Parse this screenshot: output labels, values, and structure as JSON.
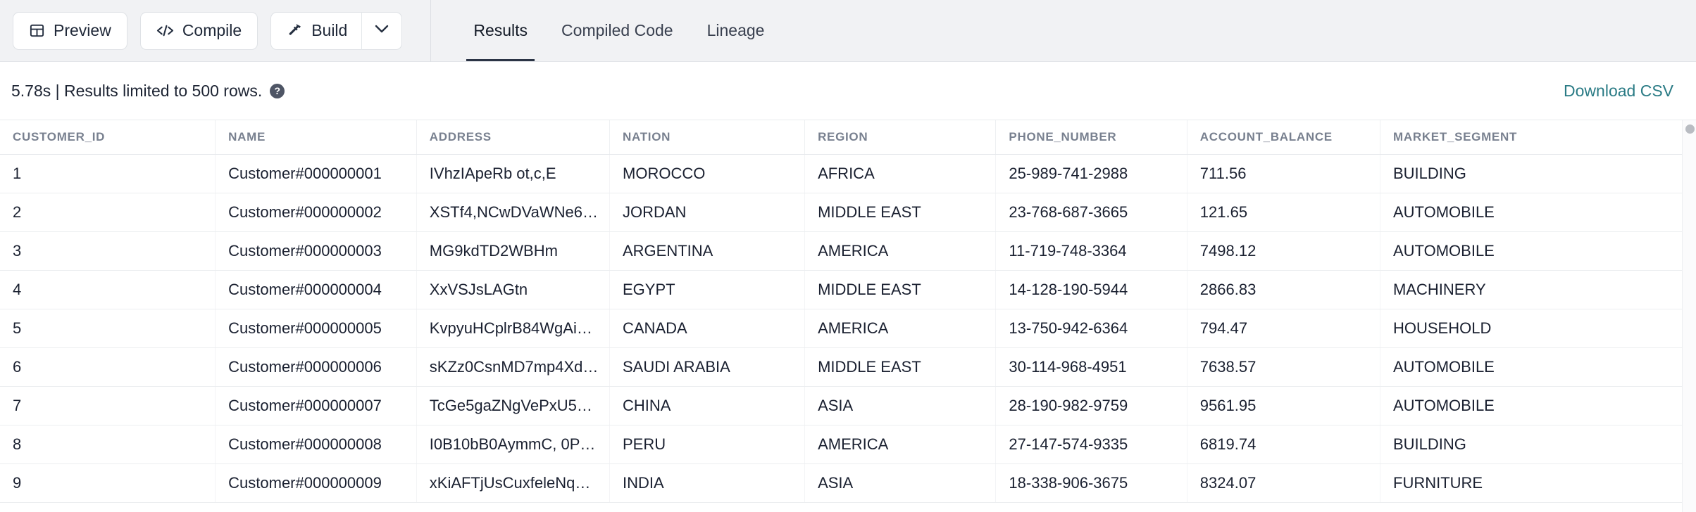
{
  "toolbar": {
    "preview_label": "Preview",
    "compile_label": "Compile",
    "build_label": "Build",
    "build_caret": "∨"
  },
  "tabs": [
    {
      "label": "Results",
      "active": true
    },
    {
      "label": "Compiled Code",
      "active": false
    },
    {
      "label": "Lineage",
      "active": false
    }
  ],
  "status": {
    "text": "5.78s | Results limited to 500 rows.",
    "help_glyph": "?",
    "download_label": "Download CSV",
    "link_color": "#2a7b85"
  },
  "table": {
    "columns": [
      "CUSTOMER_ID",
      "NAME",
      "ADDRESS",
      "NATION",
      "REGION",
      "PHONE_NUMBER",
      "ACCOUNT_BALANCE",
      "MARKET_SEGMENT"
    ],
    "rows": [
      [
        "1",
        "Customer#000000001",
        "IVhzIApeRb ot,c,E",
        "MOROCCO",
        "AFRICA",
        "25-989-741-2988",
        "711.56",
        "BUILDING"
      ],
      [
        "2",
        "Customer#000000002",
        "XSTf4,NCwDVaWNe6…",
        "JORDAN",
        "MIDDLE EAST",
        "23-768-687-3665",
        "121.65",
        "AUTOMOBILE"
      ],
      [
        "3",
        "Customer#000000003",
        "MG9kdTD2WBHm",
        "ARGENTINA",
        "AMERICA",
        "11-719-748-3364",
        "7498.12",
        "AUTOMOBILE"
      ],
      [
        "4",
        "Customer#000000004",
        "XxVSJsLAGtn",
        "EGYPT",
        "MIDDLE EAST",
        "14-128-190-5944",
        "2866.83",
        "MACHINERY"
      ],
      [
        "5",
        "Customer#000000005",
        "KvpyuHCplrB84WgAi…",
        "CANADA",
        "AMERICA",
        "13-750-942-6364",
        "794.47",
        "HOUSEHOLD"
      ],
      [
        "6",
        "Customer#000000006",
        "sKZz0CsnMD7mp4Xd…",
        "SAUDI ARABIA",
        "MIDDLE EAST",
        "30-114-968-4951",
        "7638.57",
        "AUTOMOBILE"
      ],
      [
        "7",
        "Customer#000000007",
        "TcGe5gaZNgVePxU5…",
        "CHINA",
        "ASIA",
        "28-190-982-9759",
        "9561.95",
        "AUTOMOBILE"
      ],
      [
        "8",
        "Customer#000000008",
        "I0B10bB0AymmC, 0P…",
        "PERU",
        "AMERICA",
        "27-147-574-9335",
        "6819.74",
        "BUILDING"
      ],
      [
        "9",
        "Customer#000000009",
        "xKiAFTjUsCuxfeleNq…",
        "INDIA",
        "ASIA",
        "18-338-906-3675",
        "8324.07",
        "FURNITURE"
      ]
    ]
  }
}
